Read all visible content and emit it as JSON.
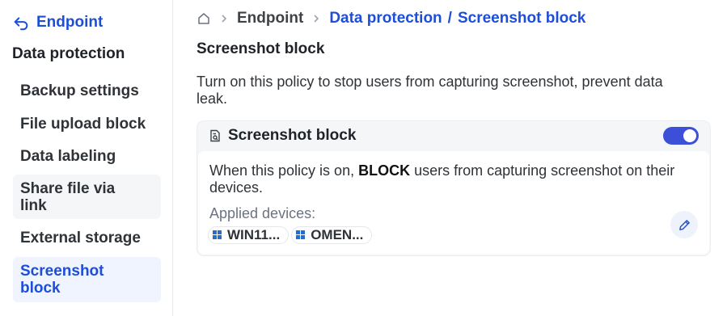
{
  "sidebar": {
    "back_label": "Endpoint",
    "heading": "Data protection",
    "items": [
      {
        "label": "Backup settings"
      },
      {
        "label": "File upload block"
      },
      {
        "label": "Data labeling"
      },
      {
        "label": "Share file via link"
      },
      {
        "label": "External storage"
      },
      {
        "label": "Screenshot block"
      }
    ]
  },
  "breadcrumb": {
    "home_icon": "home-icon",
    "items": [
      "Endpoint",
      "Data protection",
      "/",
      "Screenshot block"
    ]
  },
  "main": {
    "title": "Screenshot block",
    "description": "Turn on this policy to stop users from capturing screenshot, prevent data leak."
  },
  "policy_card": {
    "title": "Screenshot block",
    "enabled": true,
    "desc_prefix": "When this policy is on, ",
    "desc_bold": "BLOCK",
    "desc_suffix": " users from capturing screenshot on their devices.",
    "applied_label": "Applied devices:",
    "devices": [
      "WIN11...",
      "OMEN..."
    ]
  },
  "colors": {
    "accent": "#1d4ed8",
    "toggle_on": "#3b4fd8",
    "active_bg": "#eff4ff",
    "card_bg": "#f5f6f8"
  }
}
